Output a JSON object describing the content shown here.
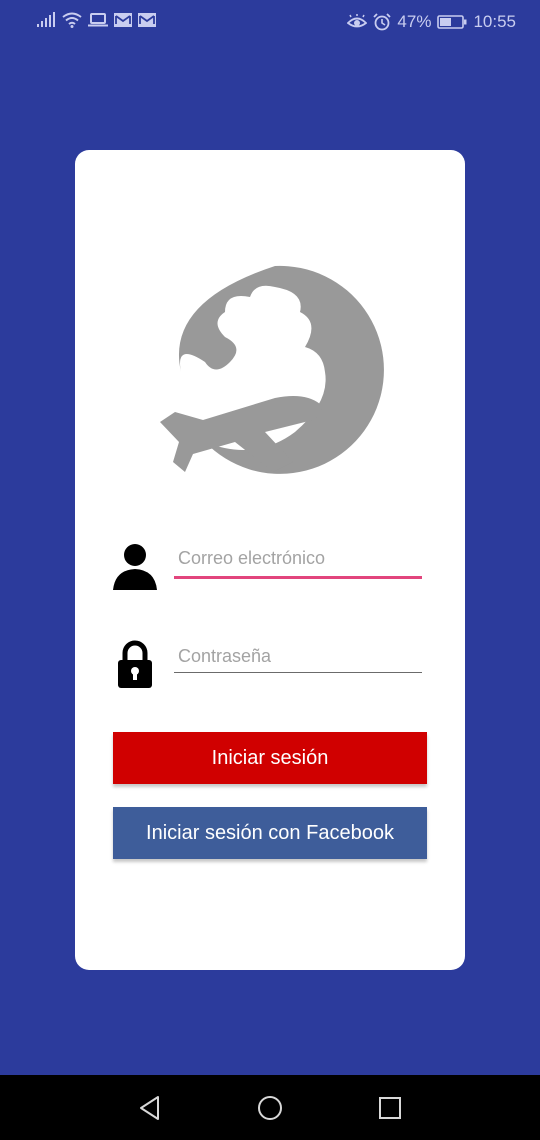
{
  "status_bar": {
    "battery": "47%",
    "time": "10:55",
    "icons": [
      "signal-icon",
      "wifi-icon",
      "laptop-icon",
      "mail-icon",
      "mail-icon",
      "eye-icon",
      "alarm-icon",
      "battery-icon"
    ]
  },
  "login_card": {
    "logo_icon": "globe-airplane-icon",
    "email": {
      "placeholder": "Correo electrónico",
      "value": "",
      "icon": "person-icon"
    },
    "password": {
      "placeholder": "Contraseña",
      "value": "",
      "icon": "lock-icon"
    },
    "login_button": "Iniciar sesión",
    "facebook_button": "Iniciar sesión con Facebook"
  },
  "colors": {
    "background": "#2c3b9c",
    "card": "#ffffff",
    "login_button": "#d00000",
    "facebook_button": "#3e5d9a",
    "focus_underline": "#e2457d",
    "logo_gray": "#999999"
  },
  "nav_bar": {
    "icons": [
      "back-icon",
      "home-icon",
      "recents-icon"
    ]
  }
}
